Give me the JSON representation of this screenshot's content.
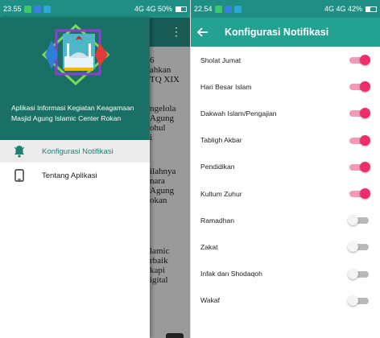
{
  "left": {
    "status_bar": {
      "time": "23.55",
      "right": "4G 4G 50%"
    },
    "background_text": [
      "6",
      "ahkan",
      "TQ XIX",
      "ngelola",
      "Agung",
      "ohul",
      "i",
      "ilahnya",
      "nara",
      "Agung",
      "okan",
      "lamic",
      "rbaik",
      "kapi",
      "igital"
    ],
    "drawer": {
      "app_title": "Aplikasi Informasi Kegiatan Keagamaan Masjid Agung Islamic Center Rokan",
      "menu": [
        {
          "label": "Konfigurasi Notifikasi",
          "icon": "bell-icon",
          "active": true
        },
        {
          "label": "Tentang Aplikasi",
          "icon": "phone-icon",
          "active": false
        }
      ]
    }
  },
  "right": {
    "status_bar": {
      "time": "22.54",
      "right": "4G 4G 42%"
    },
    "toolbar": {
      "title": "Konfigurasi Notifikasi"
    },
    "settings": [
      {
        "label": "Sholat Jumat",
        "enabled": true
      },
      {
        "label": "Hari Besar Islam",
        "enabled": true
      },
      {
        "label": "Dakwah Islam/Pengajian",
        "enabled": true
      },
      {
        "label": "Tabligh Akbar",
        "enabled": true
      },
      {
        "label": "Pendidikan",
        "enabled": true
      },
      {
        "label": "Kultum Zuhur",
        "enabled": true
      },
      {
        "label": "Ramadhan",
        "enabled": false
      },
      {
        "label": "Zakat",
        "enabled": false
      },
      {
        "label": "Infak dan Shodaqoh",
        "enabled": false
      },
      {
        "label": "Wakaf",
        "enabled": false
      }
    ]
  },
  "colors": {
    "teal_primary": "#23a191",
    "switch_on": "#ee2e6b",
    "switch_off": "#b9b9b9"
  }
}
